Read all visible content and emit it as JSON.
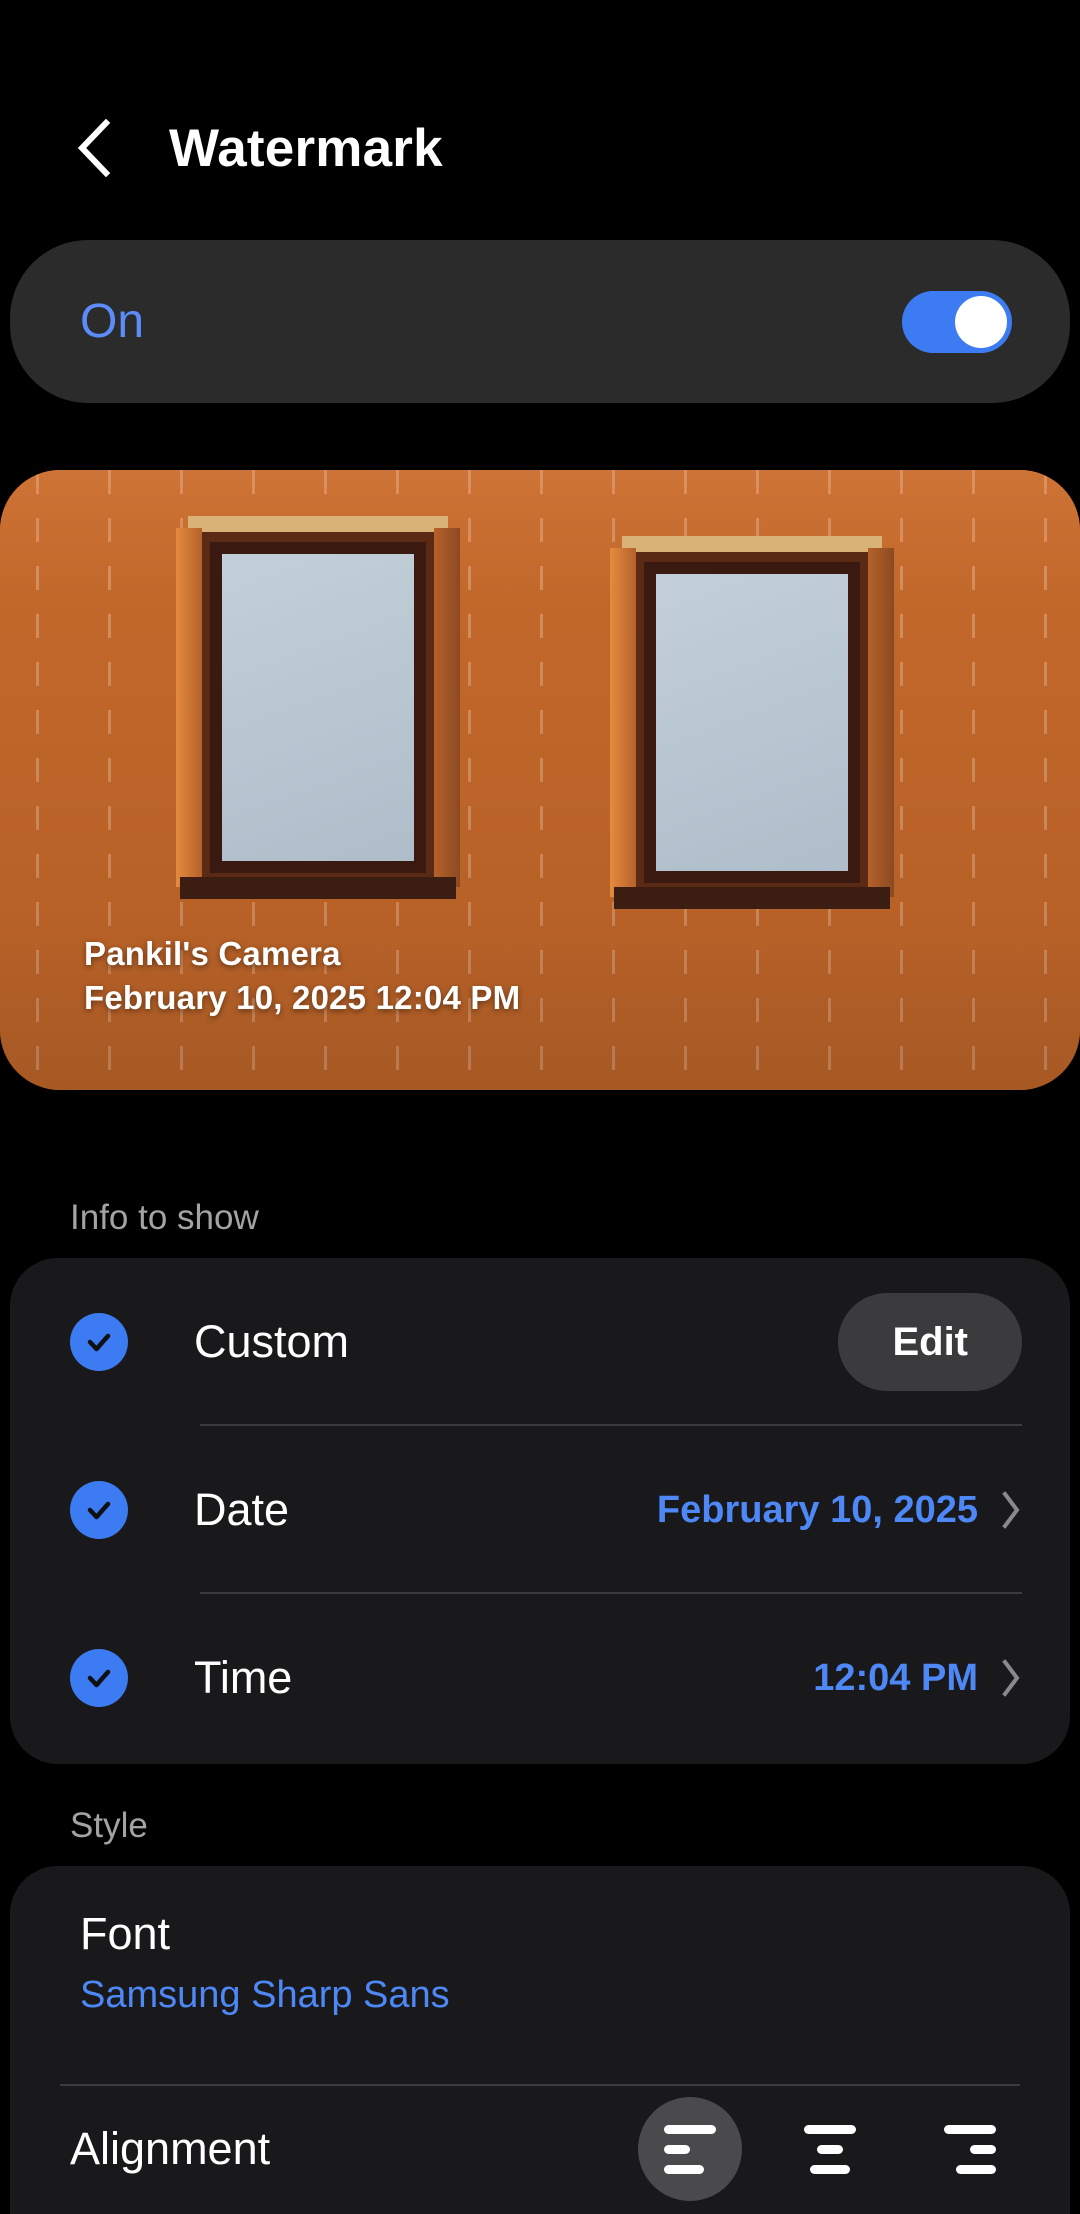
{
  "header": {
    "title": "Watermark",
    "back_icon": "chevron-left-icon"
  },
  "toggle_card": {
    "state_label": "On",
    "enabled": true,
    "accent_color": "#3d7bf2",
    "label_color": "#5c8cfa"
  },
  "preview": {
    "watermark_line1": "Pankil's Camera",
    "watermark_line2": "February 10, 2025 12:04 PM",
    "alt": "Brick wall with two windows"
  },
  "info_section": {
    "header": "Info to show",
    "rows": [
      {
        "label": "Custom",
        "checked": true,
        "action_label": "Edit",
        "type": "button"
      },
      {
        "label": "Date",
        "checked": true,
        "value": "February 10, 2025",
        "type": "link"
      },
      {
        "label": "Time",
        "checked": true,
        "value": "12:04 PM",
        "type": "link"
      }
    ]
  },
  "style_section": {
    "header": "Style",
    "font": {
      "label": "Font",
      "value": "Samsung Sharp Sans"
    },
    "alignment": {
      "label": "Alignment",
      "options": [
        {
          "name": "align-left-icon",
          "selected": true
        },
        {
          "name": "align-center-icon",
          "selected": false
        },
        {
          "name": "align-right-icon",
          "selected": false
        }
      ]
    }
  },
  "colors": {
    "background": "#000000",
    "card": "#19191b",
    "toggle_card": "#2b2b2c",
    "accent_blue": "#4e87f6",
    "muted_text": "#a3a3a3"
  }
}
